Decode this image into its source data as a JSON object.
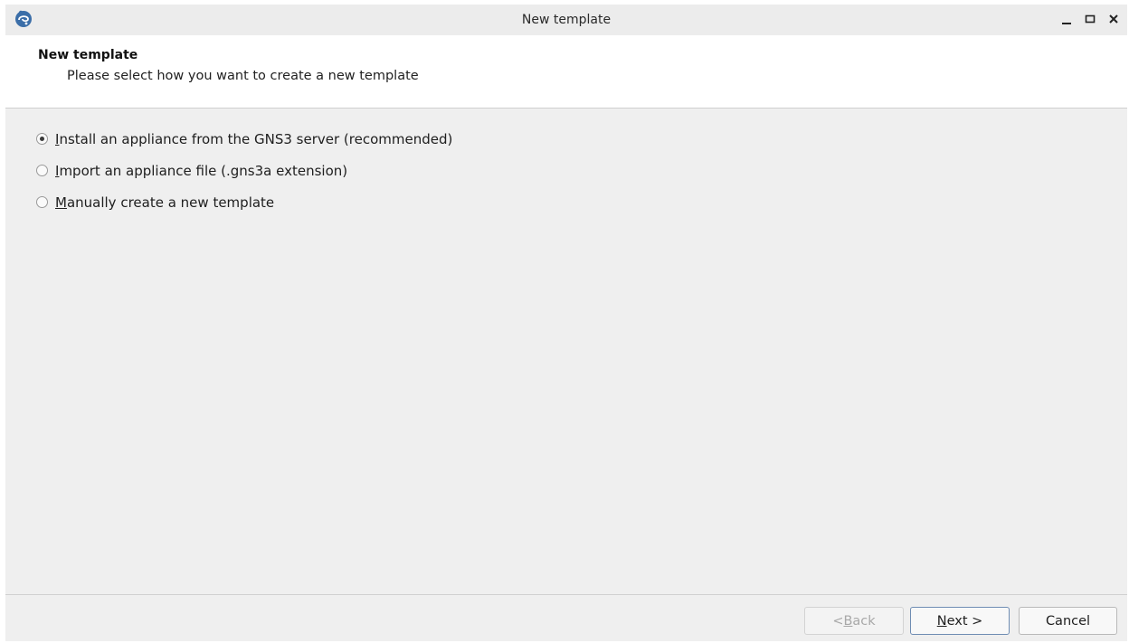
{
  "window": {
    "title": "New template",
    "controls": {
      "minimize": "_",
      "maximize": "□",
      "close": "✕"
    }
  },
  "header": {
    "title": "New template",
    "subtitle": "Please select how you want to create a new template"
  },
  "options": [
    {
      "mnemonic": "I",
      "rest": "nstall an appliance from the GNS3 server (recommended)",
      "checked": true
    },
    {
      "mnemonic": "I",
      "rest": "mport an appliance file (.gns3a extension)",
      "checked": false
    },
    {
      "mnemonic": "M",
      "rest": "anually create a new template",
      "checked": false
    }
  ],
  "buttons": {
    "back": {
      "pre": "< ",
      "mnemonic": "B",
      "rest": "ack",
      "enabled": false
    },
    "next": {
      "pre": "",
      "mnemonic": "N",
      "rest": "ext >",
      "enabled": true
    },
    "cancel": {
      "label": "Cancel",
      "enabled": true
    }
  },
  "colors": {
    "app_icon": "#3b6ea8",
    "window_bg": "#efefef",
    "header_bg": "#ffffff"
  }
}
